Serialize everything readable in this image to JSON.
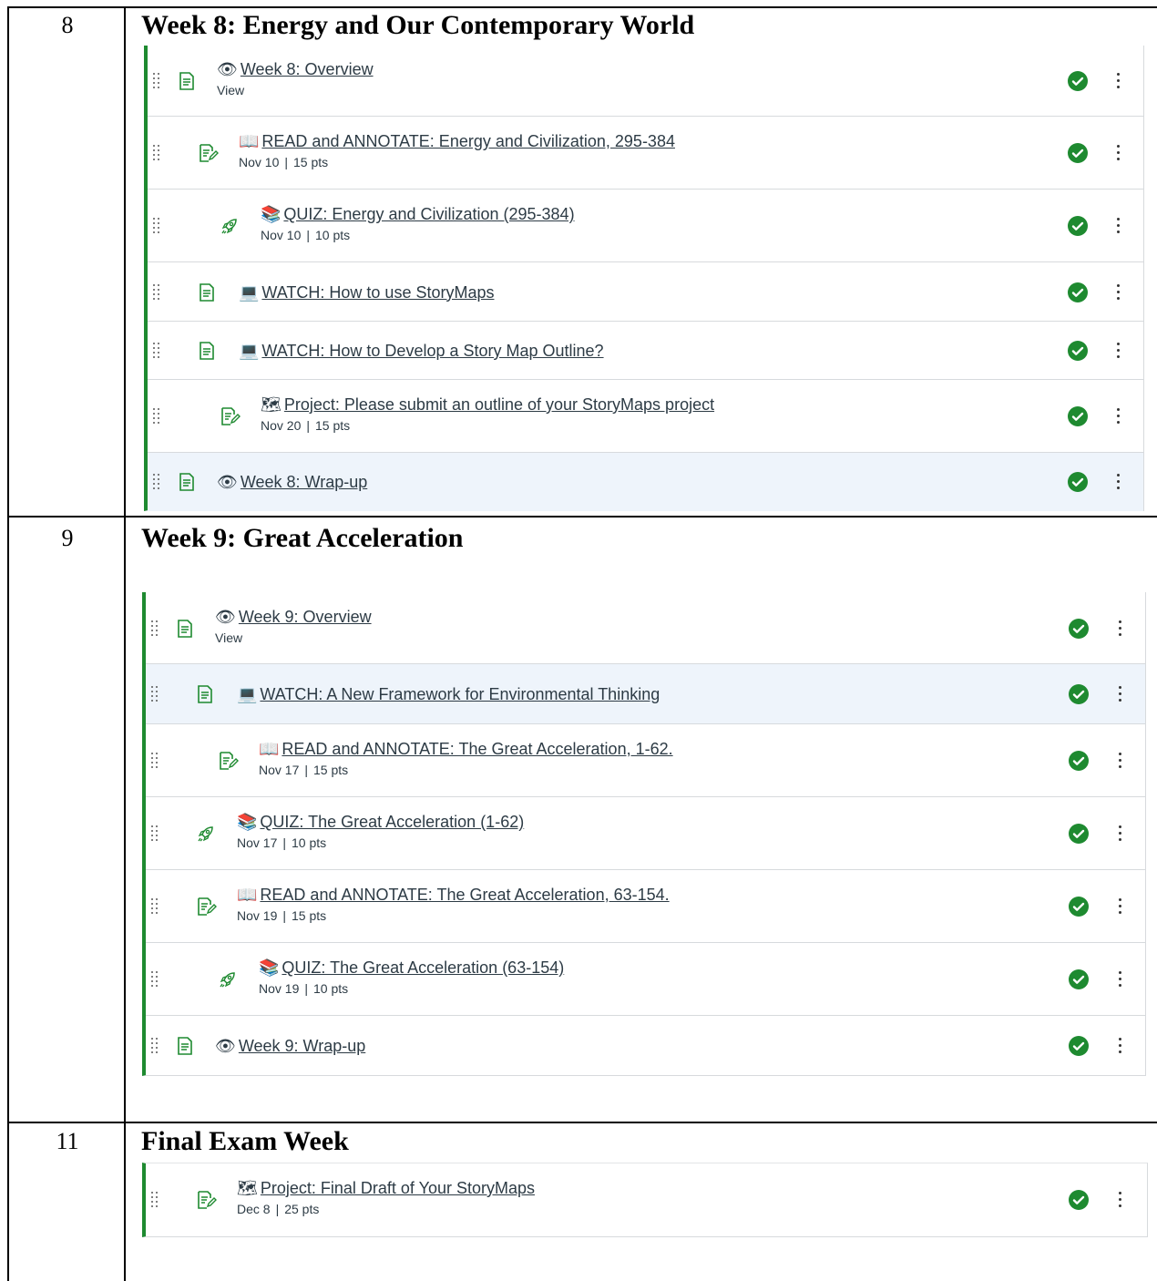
{
  "sections": [
    {
      "number": "8",
      "title": "Week 8: Energy and Our Contemporary World",
      "items": [
        {
          "icon": "page-icon",
          "emoji": "👁",
          "title": "Week 8: Overview",
          "meta_view": "View",
          "date": "",
          "pts": "",
          "status": "published-check-icon",
          "highlight": false
        },
        {
          "icon": "assignment-icon",
          "emoji": "📖",
          "title": "READ and ANNOTATE: Energy and Civilization, 295-384",
          "date": "Nov 10",
          "pts": "15 pts",
          "status": "published-check-icon",
          "highlight": false
        },
        {
          "icon": "quiz-rocket-icon",
          "emoji": "📚",
          "title": "QUIZ: Energy and Civilization (295-384)",
          "date": "Nov 10",
          "pts": "10 pts",
          "status": "published-check-icon",
          "highlight": false
        },
        {
          "icon": "page-icon",
          "emoji": "💻",
          "title": "WATCH: How to use StoryMaps",
          "date": "",
          "pts": "",
          "status": "published-check-icon",
          "highlight": false
        },
        {
          "icon": "page-icon",
          "emoji": "💻",
          "title": "WATCH: How to Develop a Story Map Outline?",
          "date": "",
          "pts": "",
          "status": "published-check-icon",
          "highlight": false
        },
        {
          "icon": "assignment-icon",
          "emoji": "🗺",
          "title": "Project: Please submit an outline of your StoryMaps project",
          "date": "Nov 20",
          "pts": "15 pts",
          "status": "published-check-icon",
          "highlight": false
        },
        {
          "icon": "page-icon",
          "emoji": "👁",
          "title": "Week 8: Wrap-up",
          "date": "",
          "pts": "",
          "status": "published-check-icon",
          "highlight": true
        }
      ]
    },
    {
      "number": "9",
      "title": "Week 9: Great Acceleration",
      "items": [
        {
          "icon": "page-icon",
          "emoji": "👁",
          "title": "Week 9: Overview",
          "meta_view": "View",
          "date": "",
          "pts": "",
          "status": "published-check-icon",
          "highlight": false
        },
        {
          "icon": "page-icon",
          "emoji": "💻",
          "title": "WATCH: A New Framework for Environmental Thinking",
          "date": "",
          "pts": "",
          "status": "published-check-icon",
          "highlight": true
        },
        {
          "icon": "assignment-icon",
          "emoji": "📖",
          "title": "READ and ANNOTATE: The Great Acceleration, 1-62.",
          "date": "Nov 17",
          "pts": "15 pts",
          "status": "published-check-icon",
          "highlight": false
        },
        {
          "icon": "quiz-rocket-icon",
          "emoji": "📚",
          "title": "QUIZ: The Great Acceleration (1-62)",
          "date": "Nov 17",
          "pts": "10 pts",
          "status": "published-check-icon",
          "highlight": false
        },
        {
          "icon": "assignment-icon",
          "emoji": "📖",
          "title": "READ and ANNOTATE: The Great Acceleration, 63-154.",
          "date": "Nov 19",
          "pts": "15 pts",
          "status": "published-check-icon",
          "highlight": false
        },
        {
          "icon": "quiz-rocket-icon",
          "emoji": "📚",
          "title": "QUIZ: The Great Acceleration (63-154)",
          "date": "Nov 19",
          "pts": "10 pts",
          "status": "published-check-icon",
          "highlight": false
        },
        {
          "icon": "page-icon",
          "emoji": "👁",
          "title": "Week 9: Wrap-up",
          "date": "",
          "pts": "",
          "status": "published-check-icon",
          "highlight": false
        }
      ]
    },
    {
      "number": "11",
      "title": "Final Exam Week",
      "items": [
        {
          "icon": "assignment-icon",
          "emoji": "🗺",
          "title": "Project: Final Draft of Your StoryMaps",
          "date": "Dec 8",
          "pts": "25 pts",
          "status": "published-check-icon",
          "highlight": false
        }
      ]
    }
  ],
  "colors": {
    "accent_green": "#1e8a30",
    "text": "#2d3b45",
    "highlight_bg": "#eef4fb"
  }
}
